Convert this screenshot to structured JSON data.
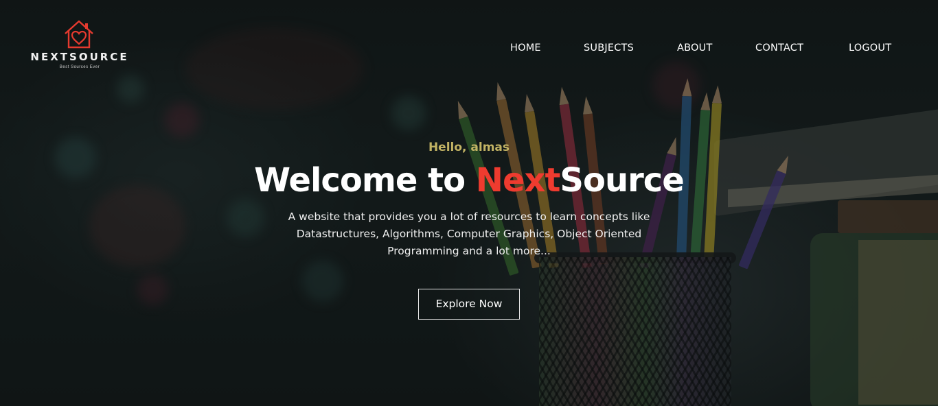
{
  "brand": {
    "name": "NEXTSOURCE",
    "tagline": "Best Sources Ever",
    "accent_color": "#ef3b2f",
    "logo_icon": "house-heart-icon"
  },
  "nav": {
    "items": [
      {
        "label": "HOME"
      },
      {
        "label": "SUBJECTS"
      },
      {
        "label": "ABOUT"
      },
      {
        "label": "CONTACT"
      },
      {
        "label": "LOGOUT"
      }
    ]
  },
  "hero": {
    "greeting": "Hello, almas",
    "title_prefix": "Welcome to ",
    "title_accent": "Next",
    "title_suffix": "Source",
    "description": "A website that provides you a lot of resources to learn concepts like Datastructures, Algorithms, Computer Graphics, Object Oriented Programming and a lot more...",
    "cta_label": "Explore Now",
    "greeting_color": "#c2b364"
  }
}
